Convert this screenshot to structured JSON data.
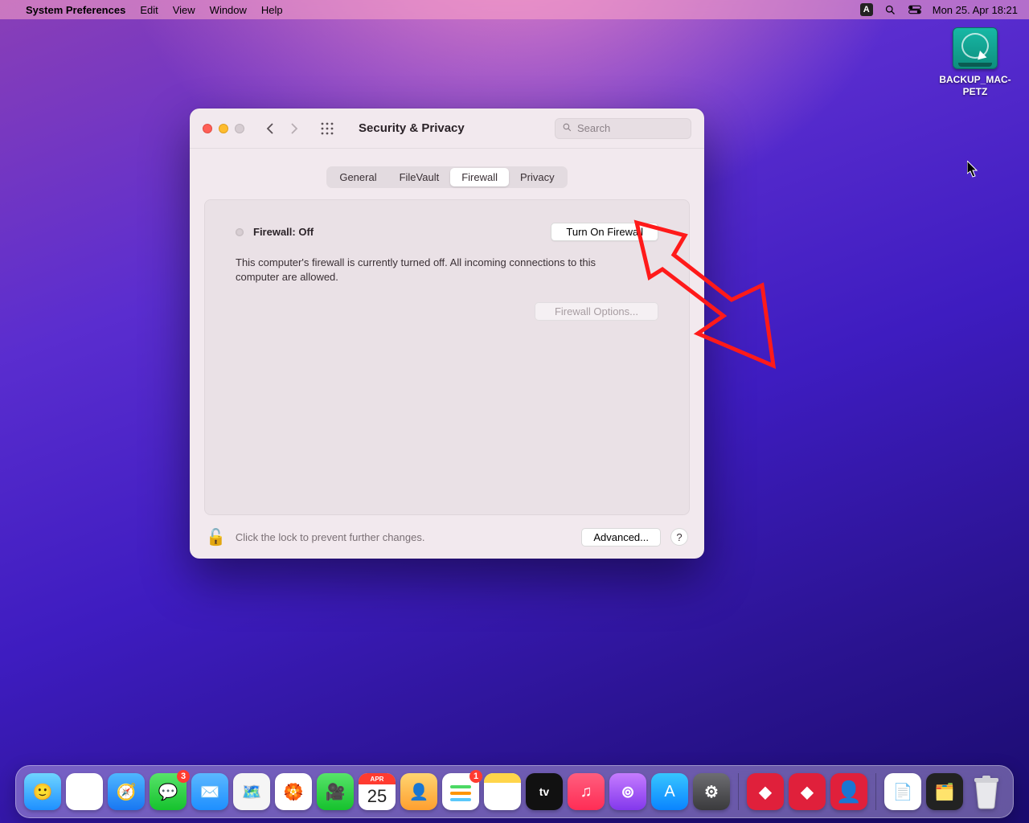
{
  "menubar": {
    "app": "System Preferences",
    "items": [
      "Edit",
      "View",
      "Window",
      "Help"
    ],
    "status_letter": "A",
    "datetime": "Mon 25. Apr  18:21"
  },
  "desktop": {
    "drive_label": "BACKUP_MAC-PETZ"
  },
  "window": {
    "title": "Security & Privacy",
    "search_placeholder": "Search",
    "tabs": [
      "General",
      "FileVault",
      "Firewall",
      "Privacy"
    ],
    "active_tab": "Firewall",
    "firewall": {
      "status": "Firewall: Off",
      "turn_on_label": "Turn On Firewall",
      "description": "This computer's firewall is currently turned off. All incoming connections to this computer are allowed.",
      "options_label": "Firewall Options..."
    },
    "footer": {
      "lock_text": "Click the lock to prevent further changes.",
      "advanced_label": "Advanced...",
      "help_label": "?"
    }
  },
  "dock": {
    "messages_badge": "3",
    "reminders_badge": "1",
    "calendar_month": "APR",
    "calendar_day": "25"
  }
}
